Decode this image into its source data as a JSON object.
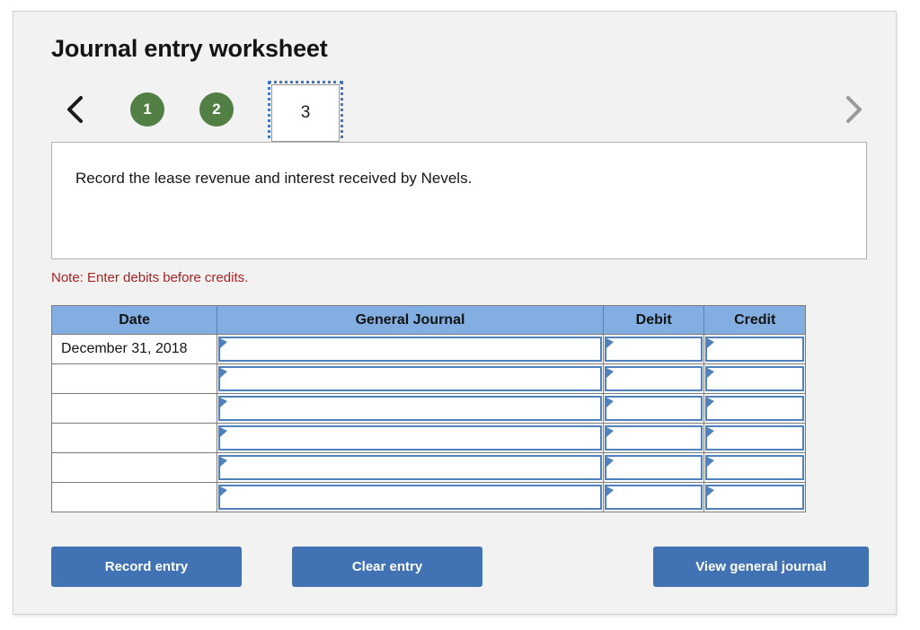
{
  "page": {
    "title": "Journal entry worksheet"
  },
  "pager": {
    "prev_icon": "chevron-left-icon",
    "next_icon": "chevron-right-icon",
    "steps": [
      {
        "label": "1",
        "state": "completed"
      },
      {
        "label": "2",
        "state": "completed"
      },
      {
        "label": "3",
        "state": "active"
      }
    ]
  },
  "description": {
    "text": "Record the lease revenue and interest received by Nevels."
  },
  "note": {
    "text": "Note: Enter debits before credits."
  },
  "journal": {
    "headers": {
      "date": "Date",
      "general_journal": "General Journal",
      "debit": "Debit",
      "credit": "Credit"
    },
    "rows": [
      {
        "date": "December 31, 2018",
        "general_journal": "",
        "debit": "",
        "credit": ""
      },
      {
        "date": "",
        "general_journal": "",
        "debit": "",
        "credit": ""
      },
      {
        "date": "",
        "general_journal": "",
        "debit": "",
        "credit": ""
      },
      {
        "date": "",
        "general_journal": "",
        "debit": "",
        "credit": ""
      },
      {
        "date": "",
        "general_journal": "",
        "debit": "",
        "credit": ""
      },
      {
        "date": "",
        "general_journal": "",
        "debit": "",
        "credit": ""
      }
    ]
  },
  "buttons": {
    "record": "Record entry",
    "clear": "Clear entry",
    "view": "View general journal"
  },
  "colors": {
    "step_completed": "#527f44",
    "header_blue": "#82aee1",
    "button_blue": "#4172b4",
    "note_red": "#a72323",
    "input_border": "#4f82bd",
    "focus_outline": "#3d79c3"
  }
}
